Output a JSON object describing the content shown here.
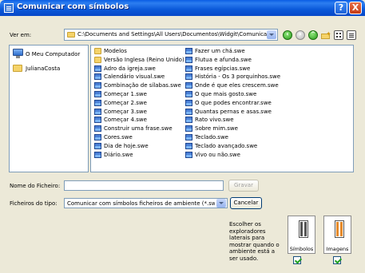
{
  "window": {
    "title": "Comunicar com símbolos",
    "help_label": "?",
    "close_label": "X"
  },
  "toolbar": {
    "look_in_label": "Ver em:",
    "path": "C:\\Documents and Settings\\All Users\\Documentos\\Widgit\\Comunicar com"
  },
  "places": [
    {
      "label": "O Meu Computador",
      "icon": "computer-icon"
    },
    {
      "label": "JulianaCosta",
      "icon": "user-folder-icon"
    }
  ],
  "files": {
    "column1": [
      {
        "name": "Modelos",
        "type": "folder"
      },
      {
        "name": "Versão Inglesa (Reino Unido)",
        "type": "folder"
      },
      {
        "name": "Adro da igreja.swe",
        "type": "swe"
      },
      {
        "name": "Calendário visual.swe",
        "type": "swe"
      },
      {
        "name": "Combinação de sílabas.swe",
        "type": "swe"
      },
      {
        "name": "Começar 1.swe",
        "type": "swe"
      },
      {
        "name": "Começar 2.swe",
        "type": "swe"
      },
      {
        "name": "Começar 3.swe",
        "type": "swe"
      },
      {
        "name": "Começar 4.swe",
        "type": "swe"
      },
      {
        "name": "Construir uma frase.swe",
        "type": "swe"
      },
      {
        "name": "Cores.swe",
        "type": "swe"
      },
      {
        "name": "Dia de hoje.swe",
        "type": "swe"
      },
      {
        "name": "Diário.swe",
        "type": "swe"
      }
    ],
    "column2": [
      {
        "name": "Fazer um chá.swe",
        "type": "swe"
      },
      {
        "name": "Flutua e afunda.swe",
        "type": "swe"
      },
      {
        "name": "Frases egípcias.swe",
        "type": "swe"
      },
      {
        "name": "História - Os 3 porquinhos.swe",
        "type": "swe"
      },
      {
        "name": "Onde é que eles crescem.swe",
        "type": "swe"
      },
      {
        "name": "O que mais gosto.swe",
        "type": "swe"
      },
      {
        "name": "O que podes encontrar.swe",
        "type": "swe"
      },
      {
        "name": "Quantas pernas e asas.swe",
        "type": "swe"
      },
      {
        "name": "Rato vivo.swe",
        "type": "swe"
      },
      {
        "name": "Sobre mim.swe",
        "type": "swe"
      },
      {
        "name": "Teclado.swe",
        "type": "swe"
      },
      {
        "name": "Teclado avançado.swe",
        "type": "swe"
      },
      {
        "name": "Vivo ou não.swe",
        "type": "swe"
      }
    ]
  },
  "bottom": {
    "filename_label": "Nome do Ficheiro:",
    "filename_value": "",
    "save_label": "Gravar",
    "filetype_label": "Ficheiros do tipo:",
    "filetype_value": "Comunicar com símbolos ficheiros de ambiente (*.swe)",
    "cancel_label": "Cancelar",
    "info_text": "Escolher os exploradores laterais para mostrar quando o ambiente está a ser usado.",
    "symbols_label": "Símbolos",
    "images_label": "Imagens",
    "symbols_checked": true,
    "images_checked": true
  },
  "colors": {
    "titlebar": "#0a58d8",
    "dialog_bg": "#ece9d8",
    "checkmark": "#21a121"
  }
}
